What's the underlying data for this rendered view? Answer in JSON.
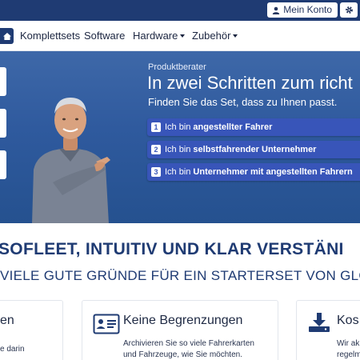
{
  "topbar": {
    "account_label": "Mein Konto",
    "user_icon": "user-icon",
    "settings_icon": "gear-icon"
  },
  "nav": {
    "home_icon": "home-icon",
    "items": [
      {
        "label": "Komplettsets"
      },
      {
        "label": "Software"
      },
      {
        "label": "Hardware"
      },
      {
        "label": "Zubehör"
      }
    ]
  },
  "hero": {
    "label": "Produktberater",
    "headline": "In zwei Schritten zum richt",
    "subline": "Finden Sie das Set, dass zu Ihnen passt.",
    "options": [
      {
        "num": "1",
        "prefix": "Ich bin",
        "bold": "angestellter Fahrer"
      },
      {
        "num": "2",
        "prefix": "Ich bin",
        "bold": "selbstfahrender Unternehmer"
      },
      {
        "num": "3",
        "prefix": "Ich bin",
        "bold": "Unternehmer mit angestellten Fahrern"
      }
    ]
  },
  "section": {
    "title": "SOFLEET, INTUITIV UND KLAR VERSTÄNI",
    "subtitle": "VIELE GUTE GRÜNDE FÜR EIN STARTERSET VON GLO"
  },
  "cards": [
    {
      "title": "en",
      "text": [
        "",
        "e darin"
      ]
    },
    {
      "title": "Keine Begrenzungen",
      "icon": "id-card-icon",
      "text": [
        "Archivieren Sie so viele Fahrerkarten",
        "und Fahrzeuge, wie Sie möchten."
      ]
    },
    {
      "title": "Kos",
      "icon": "download-icon",
      "text": [
        "Wir ak",
        "regelm"
      ]
    }
  ],
  "colors": {
    "brand_dark": "#1f3b73",
    "hero_top": "#3e68a8",
    "hero_bottom": "#25518f",
    "option_bg": "#3855b9"
  }
}
